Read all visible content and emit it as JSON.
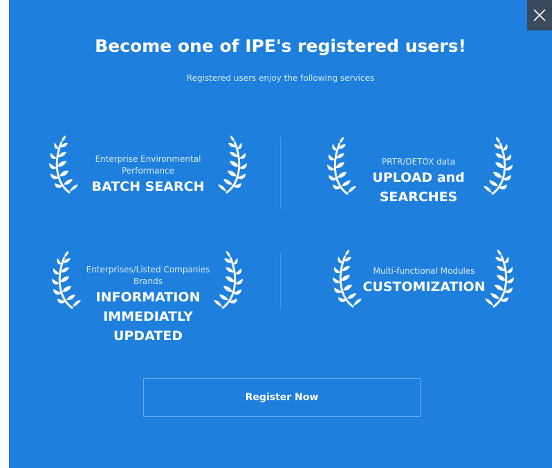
{
  "modal": {
    "title": "Become one of IPE's registered users!",
    "subtitle": "Registered users enjoy the following services",
    "close_icon": "close-icon",
    "accent_color": "#1e7fdd"
  },
  "features": [
    {
      "small": [
        "Enterprise Environmental",
        "Performance"
      ],
      "big": [
        "BATCH SEARCH"
      ]
    },
    {
      "small": [
        "PRTR/DETOX data"
      ],
      "big": [
        "UPLOAD and",
        "SEARCHES"
      ]
    },
    {
      "small": [
        "Enterprises/Listed Companies",
        "Brands"
      ],
      "big": [
        "INFORMATION",
        "IMMEDIATLY",
        "UPDATED"
      ]
    },
    {
      "small": [
        "Multi-functional Modules"
      ],
      "big": [
        "CUSTOMIZATION"
      ]
    }
  ],
  "register_button": {
    "label": "Register Now"
  }
}
